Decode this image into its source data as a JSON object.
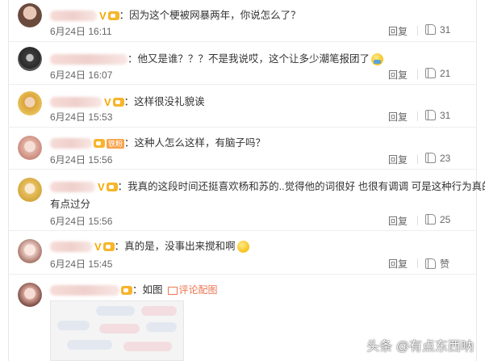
{
  "comments": [
    {
      "text": "：因为这个梗被网暴两年，你说怎么了？",
      "date": "6月24日",
      "time": "16:11",
      "reply": "回复",
      "likes": "31",
      "badge": "V",
      "avatar_color": "#6b4a3e"
    },
    {
      "text": "：他又是谁？？？不是我说哎，这个让多少潮笔报团了",
      "date": "6月24日",
      "time": "16:07",
      "reply": "回复",
      "likes": "21",
      "avatar_color": "#3c3c3c"
    },
    {
      "text": "：这样很没礼貌诶",
      "date": "6月24日",
      "time": "15:53",
      "reply": "回复",
      "likes": "31",
      "badge": "V",
      "avatar_color": "#d9a43a"
    },
    {
      "text": "：这种人怎么这样，有脑子吗？",
      "date": "6月24日",
      "time": "15:56",
      "reply": "回复",
      "likes": "23",
      "fan_label": "铁粉",
      "avatar_color": "#e3b2a6"
    },
    {
      "text": "：我真的这段时间还挺喜欢杨和苏的..觉得他的词很好 也很有调调 可是这种行为真的",
      "text2": "有点过分",
      "date": "6月24日",
      "time": "15:56",
      "reply": "回复",
      "likes": "25",
      "badge": "V",
      "avatar_color": "#e6c061"
    },
    {
      "text": "：真的是，没事出来搅和啊",
      "date": "6月24日",
      "time": "15:45",
      "reply": "回复",
      "likes": "赞",
      "badge": "V",
      "avatar_color": "#e5c6bf"
    },
    {
      "text": "：如图",
      "image_link": "评论配图",
      "avatar_color": "#d8a59a"
    }
  ],
  "watermark": "头条 @有点东西呐"
}
